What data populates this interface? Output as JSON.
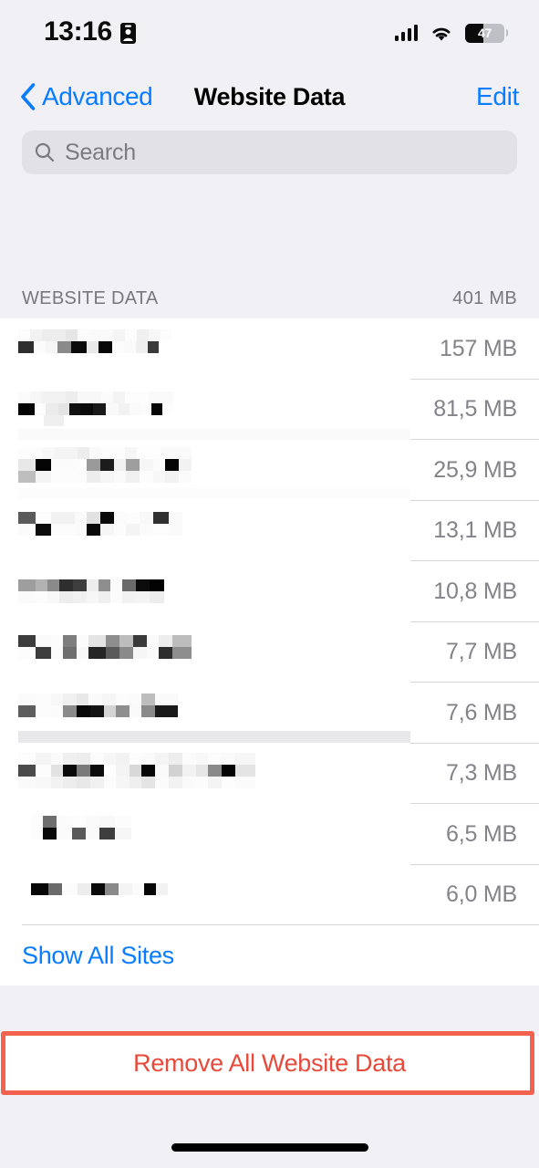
{
  "status_bar": {
    "time": "13:16",
    "badge_icon": "id-card-icon",
    "cellular_icon": "signal-bars-icon",
    "wifi_icon": "wifi-icon",
    "battery_percent": "47",
    "battery_level": 47
  },
  "nav": {
    "back_label": "Advanced",
    "back_icon": "chevron-left-icon",
    "title": "Website Data",
    "edit_label": "Edit"
  },
  "search": {
    "placeholder": "Search",
    "icon": "search-icon",
    "value": ""
  },
  "section": {
    "header_label": "WEBSITE DATA",
    "total_size": "401 MB"
  },
  "rows": [
    {
      "name": "",
      "redacted": true,
      "size": "157 MB"
    },
    {
      "name": "",
      "redacted": true,
      "size": "81,5 MB"
    },
    {
      "name": "",
      "redacted": true,
      "size": "25,9 MB"
    },
    {
      "name": "",
      "redacted": true,
      "size": "13,1 MB"
    },
    {
      "name": "",
      "redacted": true,
      "size": "10,8 MB"
    },
    {
      "name": "",
      "redacted": true,
      "size": "7,7 MB"
    },
    {
      "name": "",
      "redacted": true,
      "size": "7,6 MB"
    },
    {
      "name": "",
      "redacted": true,
      "size": "7,3 MB"
    },
    {
      "name": "",
      "redacted": true,
      "size": "6,5 MB"
    },
    {
      "name": "",
      "redacted": true,
      "size": "6,0 MB"
    }
  ],
  "show_all": {
    "label": "Show All Sites"
  },
  "remove_all": {
    "label": "Remove All Website Data"
  },
  "annotation": {
    "highlight_color": "#F2624E",
    "target": "remove-all-website-data-button"
  },
  "colors": {
    "accent_blue": "#0A7CFF",
    "destructive_red": "#E8493A",
    "page_background": "#F1F1F5",
    "cell_background": "#FFFFFF",
    "secondary_text": "#83838A",
    "separator": "#D8D8DC",
    "search_background": "#E1E1E6"
  },
  "home_indicator": {
    "visible": true
  }
}
